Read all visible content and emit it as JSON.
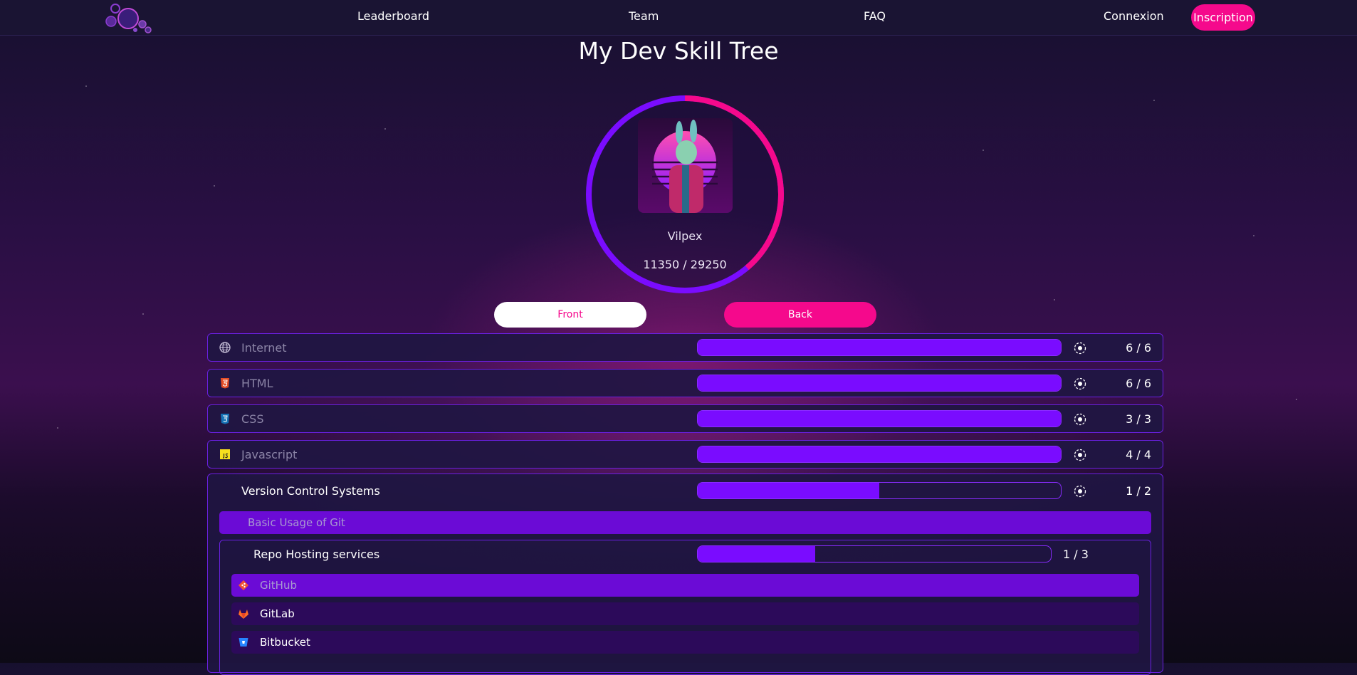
{
  "nav": {
    "links": [
      "Leaderboard",
      "Team",
      "FAQ"
    ],
    "login": "Connexion",
    "signup": "Inscription"
  },
  "hero": {
    "title": "My Dev Skill Tree",
    "username": "Vilpex",
    "score_text": "11350 / 29250",
    "score_current": 11350,
    "score_total": 29250
  },
  "tabs": {
    "front": "Front",
    "back": "Back",
    "active": "Back"
  },
  "skills": [
    {
      "label": "Internet",
      "icon": "globe-icon",
      "done": 6,
      "total": 6,
      "count": "6 / 6"
    },
    {
      "label": "HTML",
      "icon": "html5-icon",
      "done": 6,
      "total": 6,
      "count": "6 / 6"
    },
    {
      "label": "CSS",
      "icon": "css3-icon",
      "done": 3,
      "total": 3,
      "count": "3 / 3"
    },
    {
      "label": "Javascript",
      "icon": "javascript-icon",
      "done": 4,
      "total": 4,
      "count": "4 / 4"
    }
  ],
  "vcs": {
    "label": "Version Control Systems",
    "done": 1,
    "total": 2,
    "count": "1 / 2",
    "sub_item": "Basic Usage of Git",
    "repo": {
      "label": "Repo Hosting services",
      "done": 1,
      "total": 3,
      "count": "1 / 3",
      "items": [
        {
          "label": "GitHub",
          "icon": "git-icon",
          "completed": true
        },
        {
          "label": "GitLab",
          "icon": "gitlab-icon",
          "completed": false
        },
        {
          "label": "Bitbucket",
          "icon": "bitbucket-icon",
          "completed": false
        }
      ]
    }
  },
  "colors": {
    "accent_pink": "#f5098c",
    "accent_purple": "#7a0cff",
    "nav_bg": "#1a1433"
  }
}
